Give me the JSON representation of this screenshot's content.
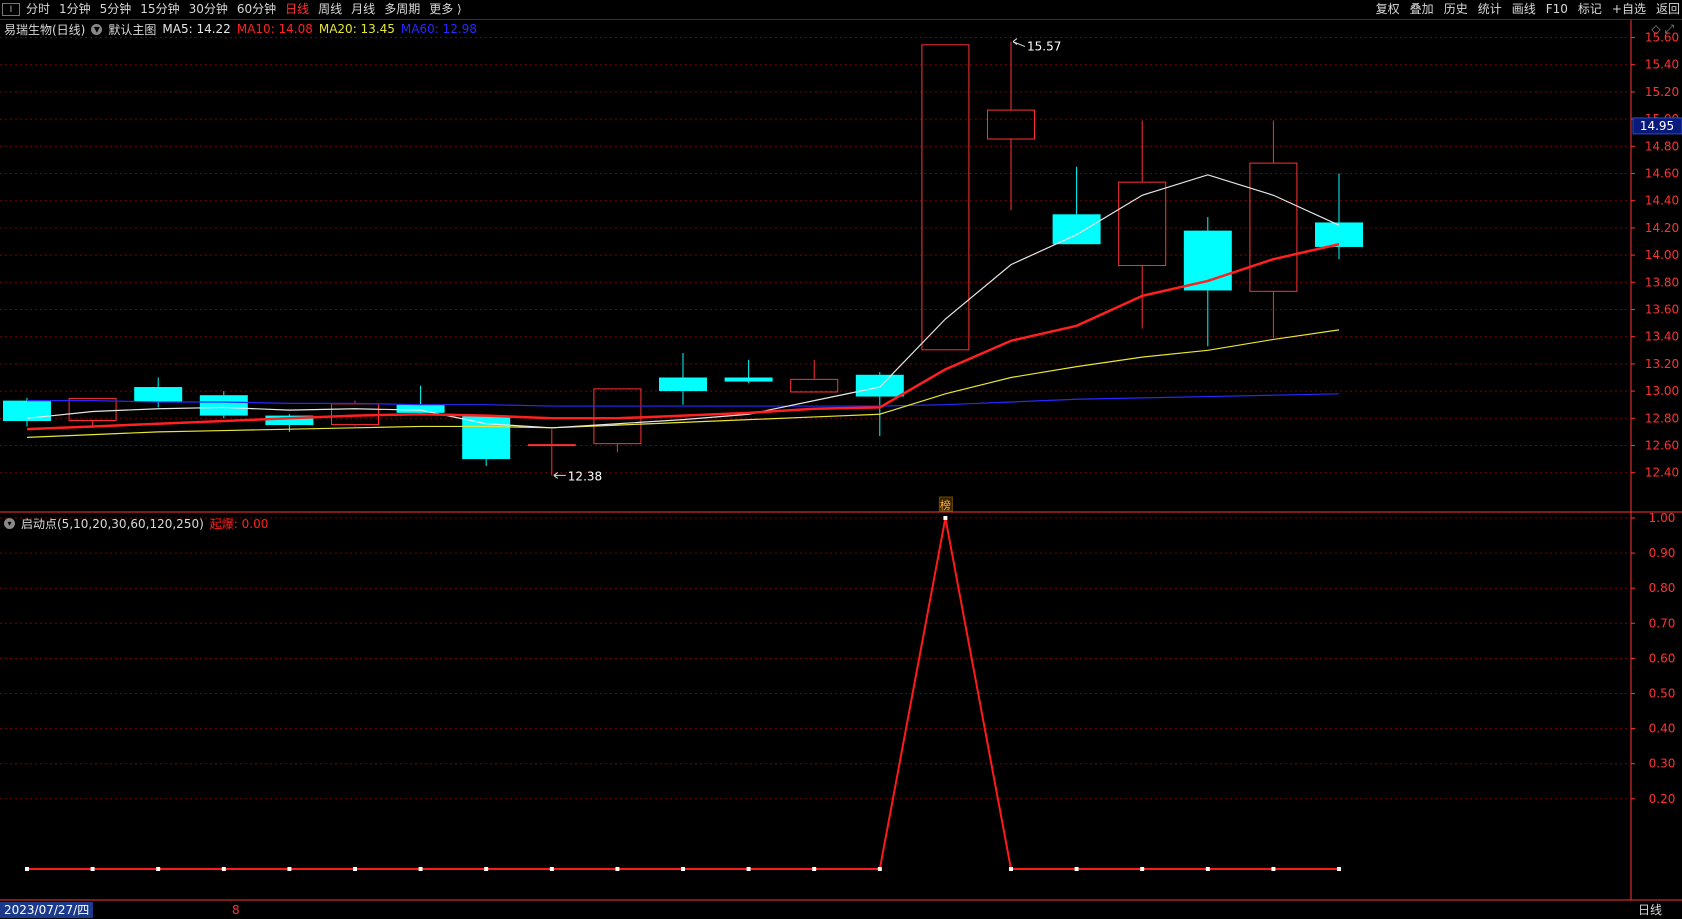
{
  "toolbar": {
    "icon": "Ⅰ",
    "periods": [
      "分时",
      "1分钟",
      "5分钟",
      "15分钟",
      "30分钟",
      "60分钟",
      "日线",
      "周线",
      "月线",
      "多周期",
      "更多 ⟩"
    ],
    "active_period": "日线",
    "right_items": [
      "复权",
      "叠加",
      "历史",
      "统计",
      "画线",
      "F10",
      "标记",
      "+自选",
      "返回"
    ]
  },
  "main_info": {
    "stock": "易瑞生物(日线)",
    "template": "默认主图",
    "ma5": "MA5: 14.22",
    "ma10": "MA10: 14.08",
    "ma20": "MA20: 13.45",
    "ma60": "MA60: 12.98",
    "right_icons": "◇ ⤢"
  },
  "indicator_info": {
    "name": "启动点(5,10,20,30,60,120,250)",
    "value": "起爆: 0.00"
  },
  "bottom": {
    "date": "2023/07/27/四",
    "marker": "8",
    "period": "日线"
  },
  "colors": {
    "up": "#ff3232",
    "down": "#00ffff",
    "ma5": "#e6e6e6",
    "ma10": "#ff2020",
    "ma20": "#e6e632",
    "ma60": "#2828ff",
    "grid": "#7a0000",
    "axis": "#ff3232"
  },
  "chart_data": [
    {
      "type": "candlestick",
      "title": "易瑞生物(日线)",
      "ylim": [
        12.28,
        15.68
      ],
      "y_ticks": [
        12.4,
        12.6,
        12.8,
        13.0,
        13.2,
        13.4,
        13.6,
        13.8,
        14.0,
        14.2,
        14.4,
        14.6,
        14.8,
        15.0,
        15.2,
        15.4,
        15.6
      ],
      "current_price": "14.95",
      "high_label": "15.57",
      "low_label": "12.38",
      "event_marker": "榜",
      "candles": [
        {
          "o": 12.93,
          "h": 12.95,
          "l": 12.74,
          "c": 12.78
        },
        {
          "o": 12.78,
          "h": 12.95,
          "l": 12.73,
          "c": 12.95
        },
        {
          "o": 13.03,
          "h": 13.1,
          "l": 12.88,
          "c": 12.92
        },
        {
          "o": 12.97,
          "h": 13.0,
          "l": 12.8,
          "c": 12.82
        },
        {
          "o": 12.82,
          "h": 12.83,
          "l": 12.7,
          "c": 12.75
        },
        {
          "o": 12.75,
          "h": 12.93,
          "l": 12.74,
          "c": 12.91
        },
        {
          "o": 12.9,
          "h": 13.04,
          "l": 12.86,
          "c": 12.84
        },
        {
          "o": 12.82,
          "h": 12.82,
          "l": 12.45,
          "c": 12.5
        },
        {
          "o": 12.61,
          "h": 12.72,
          "l": 12.38,
          "c": 12.61
        },
        {
          "o": 12.61,
          "h": 13.02,
          "l": 12.55,
          "c": 13.02
        },
        {
          "o": 13.1,
          "h": 13.28,
          "l": 12.9,
          "c": 13.0
        },
        {
          "o": 13.1,
          "h": 13.23,
          "l": 13.06,
          "c": 13.07
        },
        {
          "o": 12.99,
          "h": 13.23,
          "l": 12.99,
          "c": 13.09
        },
        {
          "o": 13.12,
          "h": 13.14,
          "l": 12.67,
          "c": 12.96
        },
        {
          "o": 13.3,
          "h": 15.55,
          "l": 13.3,
          "c": 15.55
        },
        {
          "o": 14.85,
          "h": 15.57,
          "l": 14.33,
          "c": 15.07
        },
        {
          "o": 14.3,
          "h": 14.65,
          "l": 14.08,
          "c": 14.08
        },
        {
          "o": 13.92,
          "h": 14.99,
          "l": 13.46,
          "c": 14.54
        },
        {
          "o": 14.18,
          "h": 14.28,
          "l": 13.33,
          "c": 13.74
        },
        {
          "o": 13.73,
          "h": 14.99,
          "l": 13.39,
          "c": 14.68
        },
        {
          "o": 14.24,
          "h": 14.6,
          "l": 13.97,
          "c": 14.06
        }
      ],
      "ma5": [
        12.8,
        12.85,
        12.87,
        12.88,
        12.86,
        12.87,
        12.86,
        12.76,
        12.73,
        12.76,
        12.79,
        12.83,
        12.93,
        13.03,
        13.53,
        13.93,
        14.15,
        14.44,
        14.59,
        14.44,
        14.22
      ],
      "ma10": [
        12.72,
        12.74,
        12.76,
        12.78,
        12.8,
        12.82,
        12.83,
        12.82,
        12.8,
        12.8,
        12.82,
        12.84,
        12.87,
        12.88,
        13.16,
        13.37,
        13.48,
        13.7,
        13.81,
        13.97,
        14.08
      ],
      "ma20": [
        12.66,
        12.68,
        12.7,
        12.71,
        12.72,
        12.73,
        12.74,
        12.74,
        12.73,
        12.75,
        12.77,
        12.79,
        12.81,
        12.83,
        12.98,
        13.1,
        13.18,
        13.25,
        13.3,
        13.38,
        13.45
      ],
      "ma60": [
        12.93,
        12.93,
        12.92,
        12.92,
        12.91,
        12.91,
        12.9,
        12.9,
        12.89,
        12.89,
        12.89,
        12.89,
        12.89,
        12.89,
        12.9,
        12.92,
        12.94,
        12.95,
        12.96,
        12.97,
        12.98
      ]
    },
    {
      "type": "line",
      "title": "启动点(5,10,20,30,60,120,250)",
      "ylim": [
        0,
        1.02
      ],
      "y_ticks": [
        0.2,
        0.3,
        0.4,
        0.5,
        0.6,
        0.7,
        0.8,
        0.9,
        1.0
      ],
      "series": [
        {
          "name": "起爆",
          "values": [
            0,
            0,
            0,
            0,
            0,
            0,
            0,
            0,
            0,
            0,
            0,
            0,
            0,
            0,
            1,
            0,
            0,
            0,
            0,
            0,
            0
          ]
        }
      ]
    }
  ]
}
